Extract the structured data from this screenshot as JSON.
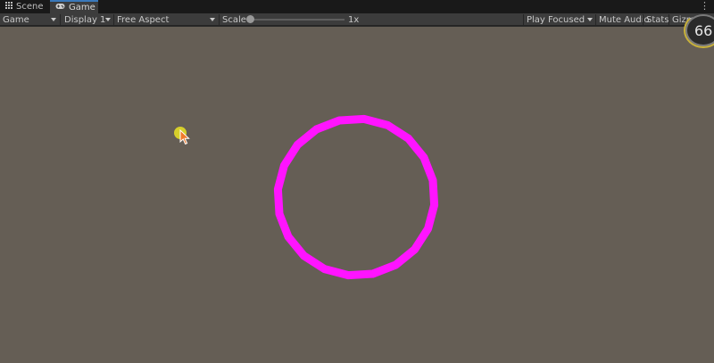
{
  "tabs": [
    {
      "label": "Scene",
      "icon": "grid-icon"
    },
    {
      "label": "Game",
      "icon": "gamepad-icon"
    }
  ],
  "toolbar": {
    "game_view": "Game",
    "display": "Display 1",
    "aspect": "Free Aspect",
    "scale_label": "Scale",
    "scale_value": "1x",
    "play_mode": "Play Focused",
    "mute_audio": "Mute Audio",
    "stats": "Stats",
    "gizmos": "Gizmo"
  },
  "fps": "66",
  "colors": {
    "viewport_bg": "#655e55",
    "circle": "#ff14ff",
    "cursor_dot": "#d6cf2b",
    "tab_accent": "#3a79bb"
  },
  "scene": {
    "circle_segments": 20
  }
}
